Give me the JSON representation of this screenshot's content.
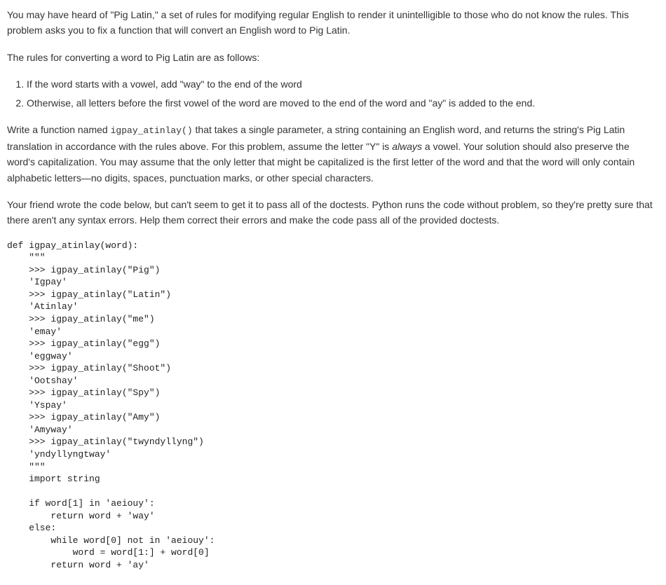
{
  "intro": {
    "p1": "You may have heard of \"Pig Latin,\" a set of rules for modifying regular English to render it unintelligible to those who do not know the rules. This problem asks you to fix a function that will convert an English word to Pig Latin.",
    "p2": "The rules for converting a word to Pig Latin are as follows:"
  },
  "rules": {
    "r1": "If the word starts with a vowel, add \"way\" to the end of the word",
    "r2": "Otherwise, all letters before the first vowel of the word are moved to the end of the word and \"ay\" is added to the end."
  },
  "task": {
    "pre": "Write a function named ",
    "fn": "igpay_atinlay()",
    "mid1": " that takes a single parameter, a string containing an English word, and returns the string's Pig Latin translation in accordance with the rules above. For this problem, assume the letter \"Y\" is ",
    "em": "always",
    "mid2": " a vowel. Your solution should also preserve the word's capitalization. You may assume that the only letter that might be capitalized is the first letter of the word and that the word will only contain alphabetic letters—no digits, spaces, punctuation marks, or other special characters."
  },
  "friend": "Your friend wrote the code below, but can't seem to get it to pass all of the doctests. Python runs the code without problem, so they're pretty sure that there aren't any syntax errors. Help them correct their errors and make the code pass all of the provided doctests.",
  "code": "def igpay_atinlay(word):\n    \"\"\"\n    >>> igpay_atinlay(\"Pig\")\n    'Igpay'\n    >>> igpay_atinlay(\"Latin\")\n    'Atinlay'\n    >>> igpay_atinlay(\"me\")\n    'emay'\n    >>> igpay_atinlay(\"egg\")\n    'eggway'\n    >>> igpay_atinlay(\"Shoot\")\n    'Ootshay'\n    >>> igpay_atinlay(\"Spy\")\n    'Yspay'\n    >>> igpay_atinlay(\"Amy\")\n    'Amyway'\n    >>> igpay_atinlay(\"twyndyllyng\")\n    'yndyllyngtway'\n    \"\"\"\n    import string\n\n    if word[1] in 'aeiouy':\n        return word + 'way'\n    else:\n        while word[0] not in 'aeiouy':\n            word = word[1:] + word[0]\n        return word + 'ay'"
}
